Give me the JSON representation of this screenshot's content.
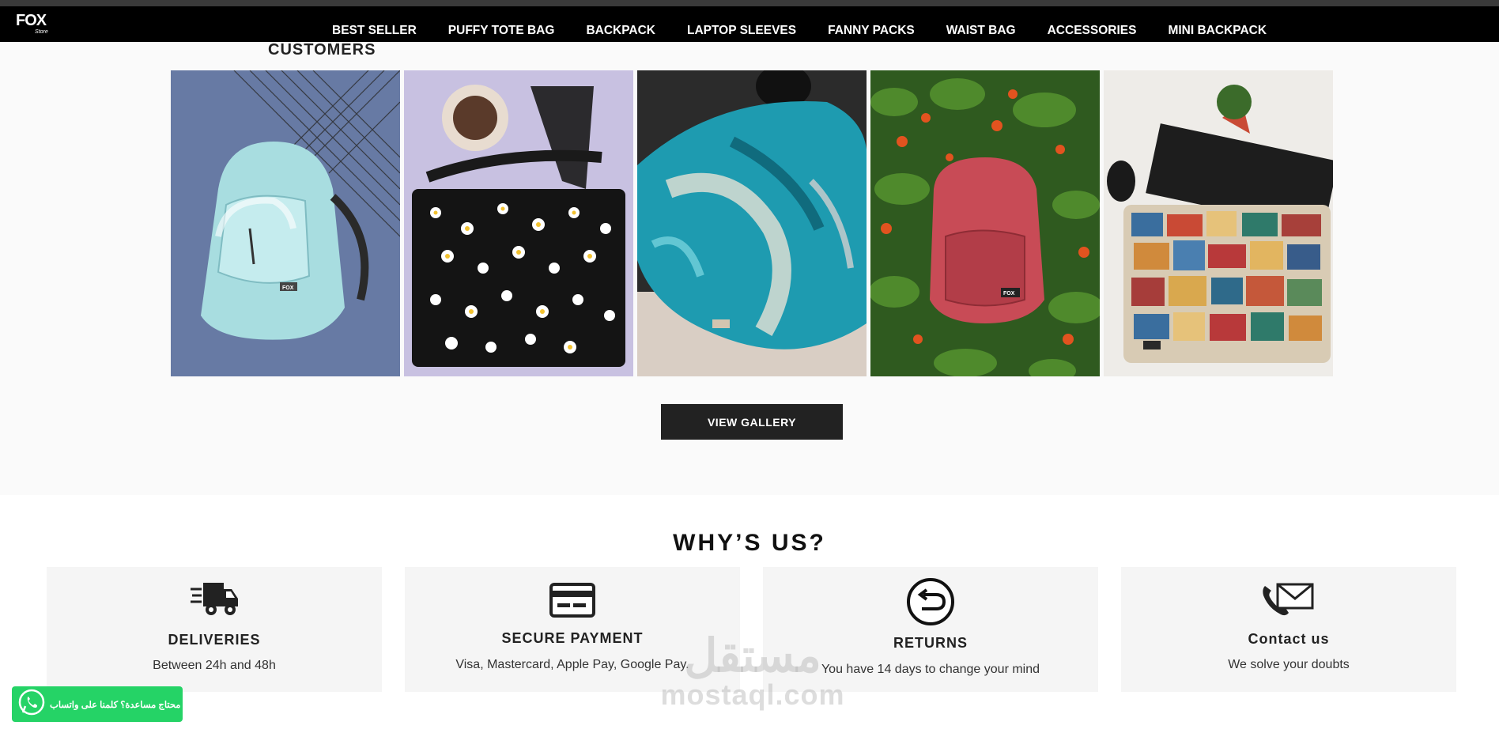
{
  "brand": {
    "logo": "FOX",
    "tagline": "Store"
  },
  "nav": {
    "items": [
      "BEST SELLER",
      "PUFFY TOTE BAG",
      "BACKPACK",
      "LAPTOP SLEEVES",
      "FANNY PACKS",
      "WAIST BAG",
      "ACCESSORIES",
      "MINI BACKPACK"
    ]
  },
  "customers": {
    "heading": "CUSTOMERS",
    "button": "VIEW GALLERY"
  },
  "why": {
    "title": "WHY’S US?",
    "cards": [
      {
        "icon": "delivery-truck-icon",
        "title": "DELIVERIES",
        "desc": "Between 24h and 48h"
      },
      {
        "icon": "credit-card-icon",
        "title": "SECURE PAYMENT",
        "desc": "Visa, Mastercard, Apple Pay, Google Pay."
      },
      {
        "icon": "return-arrow-icon",
        "title": "RETURNS",
        "desc": "You have 14 days to change your mind"
      },
      {
        "icon": "phone-mail-icon",
        "title": "Contact us",
        "desc": "We solve your doubts"
      }
    ]
  },
  "watermark": {
    "arabic": "مستقل",
    "latin": "mostaql.com"
  },
  "whatsapp": {
    "label": "محتاج مساعدة؟ كلمنا على واتساب"
  },
  "colors": {
    "navbar": "#000000",
    "button": "#222222",
    "whatsapp": "#25d366",
    "card_bg": "#f5f5f5"
  }
}
